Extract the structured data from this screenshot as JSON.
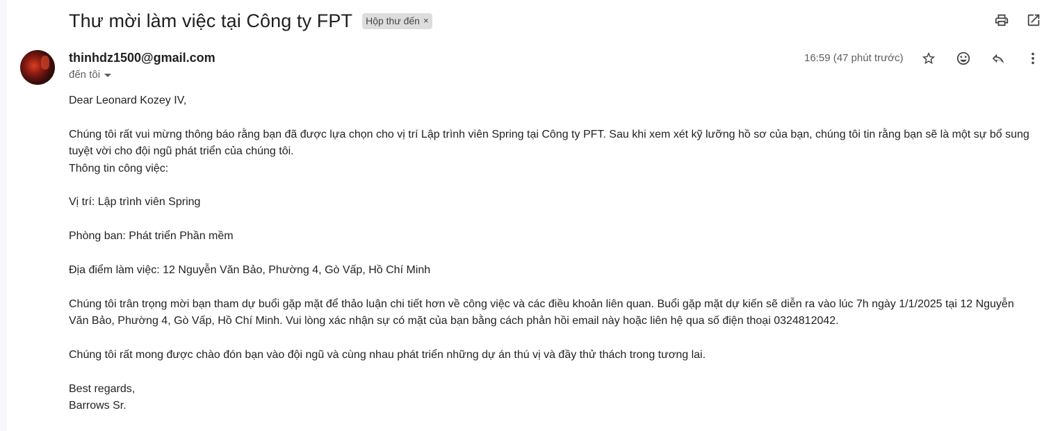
{
  "email": {
    "subject": "Thư mời làm việc tại Công ty FPT",
    "label": "Hộp thư đến",
    "label_remove": "×",
    "sender": "thinhdz1500@gmail.com",
    "recipient": "đến tôi",
    "time": "16:59 (47 phút trước)"
  },
  "icons": {
    "print": "print-icon",
    "open_new_window": "open-in-new-window-icon",
    "star": "star-icon",
    "emoji": "emoji-reaction-icon",
    "reply": "reply-icon",
    "more": "more-vert-icon",
    "expand_details": "chevron-down-icon"
  },
  "body": {
    "greeting": "Dear Leonard Kozey IV,",
    "intro": "Chúng tôi rất vui mừng thông báo rằng bạn đã được lựa chọn cho vị trí Lập trình viên Spring tại Công ty PFT. Sau khi xem xét kỹ lưỡng hồ sơ của bạn, chúng tôi tin rằng bạn sẽ là một sự bổ sung tuyệt vời cho đội ngũ phát triển của chúng tôi.",
    "job_info_heading": "Thông tin công việc:",
    "position": "Vị trí: Lập trình viên Spring",
    "department": "Phòng ban: Phát triển Phần mềm",
    "location": "Địa điểm làm việc: 12 Nguyễn Văn Bảo, Phường 4, Gò Vấp, Hồ Chí Minh",
    "meeting": "Chúng tôi trân trọng mời bạn tham dự buổi gặp mặt để thảo luận chi tiết hơn về công việc và các điều khoản liên quan. Buổi gặp mặt dự kiến sẽ diễn ra vào lúc 7h ngày 1/1/2025 tại 12 Nguyễn Văn Bảo, Phường 4, Gò Vấp, Hồ Chí Minh. Vui lòng xác nhận sự có mặt của bạn bằng cách phản hồi email này hoặc liên hệ qua số điện thoại 0324812042.",
    "closing_line": "Chúng tôi rất mong được chào đón bạn vào đội ngũ và cùng nhau phát triển những dự án thú vị và đầy thử thách trong tương lai.",
    "signoff": "Best regards,",
    "signature": "Barrows Sr."
  },
  "colors": {
    "text_primary": "#1f1f1f",
    "text_secondary": "#5e5e5e",
    "label_bg": "#dddddd",
    "icon": "#444746"
  }
}
